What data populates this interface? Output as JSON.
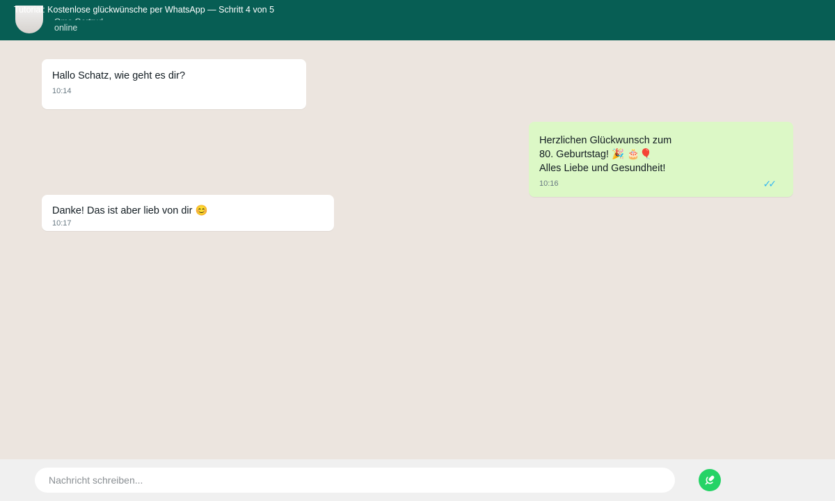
{
  "header": {
    "tutorial_title": "Tutorial: Kostenlose glückwünsche per WhatsApp — Schritt 4 von 5",
    "contact_name": "Oma Gertrud",
    "presence": "online",
    "background_color": "#075e54"
  },
  "messages": [
    {
      "direction": "incoming",
      "text": "Hallo Schatz, wie geht es dir?",
      "time": "10:14"
    },
    {
      "direction": "outgoing",
      "text": "Herzlichen Glückwunsch zum\n80. Geburtstag! 🎉 🎂🎈\nAlles Liebe und Gesundheit!",
      "time": "10:16",
      "status": "read",
      "status_icon": "double-check-icon",
      "ticks": "✓✓"
    },
    {
      "direction": "incoming",
      "text": "Danke! Das ist aber lieb von dir 😊",
      "time": "10:17"
    }
  ],
  "composer": {
    "placeholder": "Nachricht schreiben...",
    "value": "",
    "send_icon": "microphone-icon"
  },
  "colors": {
    "chat_background": "#ece5df",
    "incoming_bubble": "#ffffff",
    "outgoing_bubble": "#dcf8c6",
    "read_ticks": "#34b7f1",
    "accent": "#25d366"
  }
}
